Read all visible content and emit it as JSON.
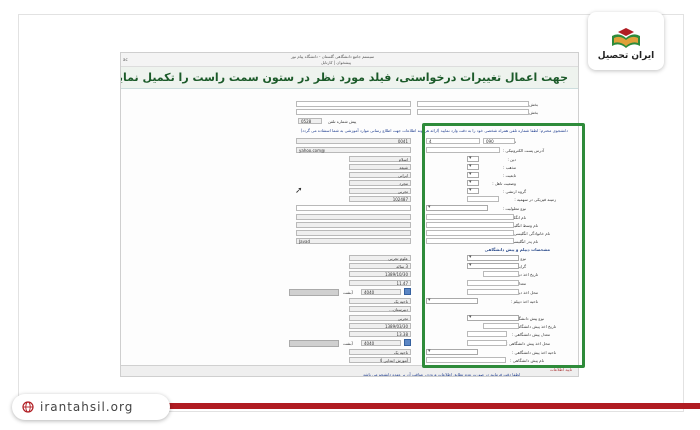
{
  "watermark": {
    "brand": "ایران تحصیل",
    "url": "irantahsil.org",
    "colors": {
      "brand_red": "#b01c22",
      "brand_green": "#2e8b3a",
      "brand_gold": "#e0a13a"
    }
  },
  "page": {
    "top_left": "ac",
    "top_line_1": "سیستم جامع دانشگاهی گلستان - دانشگاه پیام نور",
    "top_line_2": "پیشخوان  |  کارتابل",
    "title": "جهت اعمال تغییرات درخواستی، فیلد مورد نظر در ستون سمت راست را تکمیل نمایید",
    "title_color": "#1b5a29"
  },
  "form": {
    "labels": {
      "address2": "بخش دوم آدرس :",
      "address3": "بخش سوم آدرس :",
      "phone_prefix": "پیش شماره تلفن",
      "landline": "تلفن ثابت :",
      "email": "آدرس پست الکترونیکی :",
      "religion": "دین :",
      "sect": "مذهب :",
      "nationality": "تابعیت :",
      "marital": "وضعیت تاهل :",
      "special_group": "گروه ارتشی :",
      "health": "زمینه فیزیکی در سهمیه :",
      "disability": "نوع معلولیت :",
      "name_en": "نام انگلیسی :",
      "middle_en": "نام وسط انگلیسی :",
      "family_en": "نام خانوادگی انگلیسی :",
      "father_en": "نام پدر انگلیسی :",
      "diploma_type": "نوع دیپلم :",
      "diploma_field": "گرایش دیپلم :",
      "diploma_date": "تاریخ اخذ دیپلم :",
      "diploma_avg": "معدل دیپلم :",
      "diploma_place": "محل اخذ دیپلم :",
      "diploma_region": "ناحیه اخذ دیپلم :",
      "pre_type": "نوع پیش دانشگاهی :",
      "pre_date": "تاریخ اخذ پیش دانشگاهی :",
      "pre_avg": "معدل پیش دانشگاهی :",
      "pre_place": "محل اخذ پیش دانشگاهی :",
      "pre_region": "ناحیه اخذ پیش دانشگاهی :",
      "pre_school": "نام پیش دانشگاهی :"
    },
    "section_diploma": "مشخصات دیپلم و پیش دانشگاهی",
    "note_top": "دانشجوی محترم: لطفا شماره تلفن همراه شخصی خود را به دقت وارد نمایید (ارائه هرگونه اطلاعات جهت اطلاع رسانی موارد آموزشی به شما استفاده می گردد)",
    "current": {
      "phone_code": "0528",
      "phone_num": "0041",
      "email": "@yahoo.com",
      "religion": "اسلام",
      "sect": "شیعه",
      "nationality": "ایرانی",
      "marital": "مجرد",
      "group": "تجربی",
      "zone_code": "102487",
      "name_en": "Javad",
      "diploma_type": "علوم تجربی",
      "diploma_grade": "3 ساله",
      "diploma_date": "1389/10/30",
      "diploma_avg": "11.47",
      "diploma_zip": "4040",
      "diploma_place_label": "آبشت",
      "diploma_region": "ناحیه یک",
      "diploma_school": "دبیرستان...",
      "pre_type": "تجربی",
      "pre_date": "1389/03/30",
      "pre_avg": "13.38",
      "pre_zip": "4040",
      "pre_place_label": "آبشت",
      "pre_region": "ناحیه یک",
      "pre_school": "آموزش ابتدایی 4"
    },
    "right": {
      "phone_code": "090",
      "phone_num": "4"
    },
    "footer_note": "لطفا دقت فرمایید در صورت عدم تطابق اطلاعات ورودی، عواقب آن بر عهده دانشجو می باشد",
    "footer_label": "تایید اطلاعات"
  }
}
